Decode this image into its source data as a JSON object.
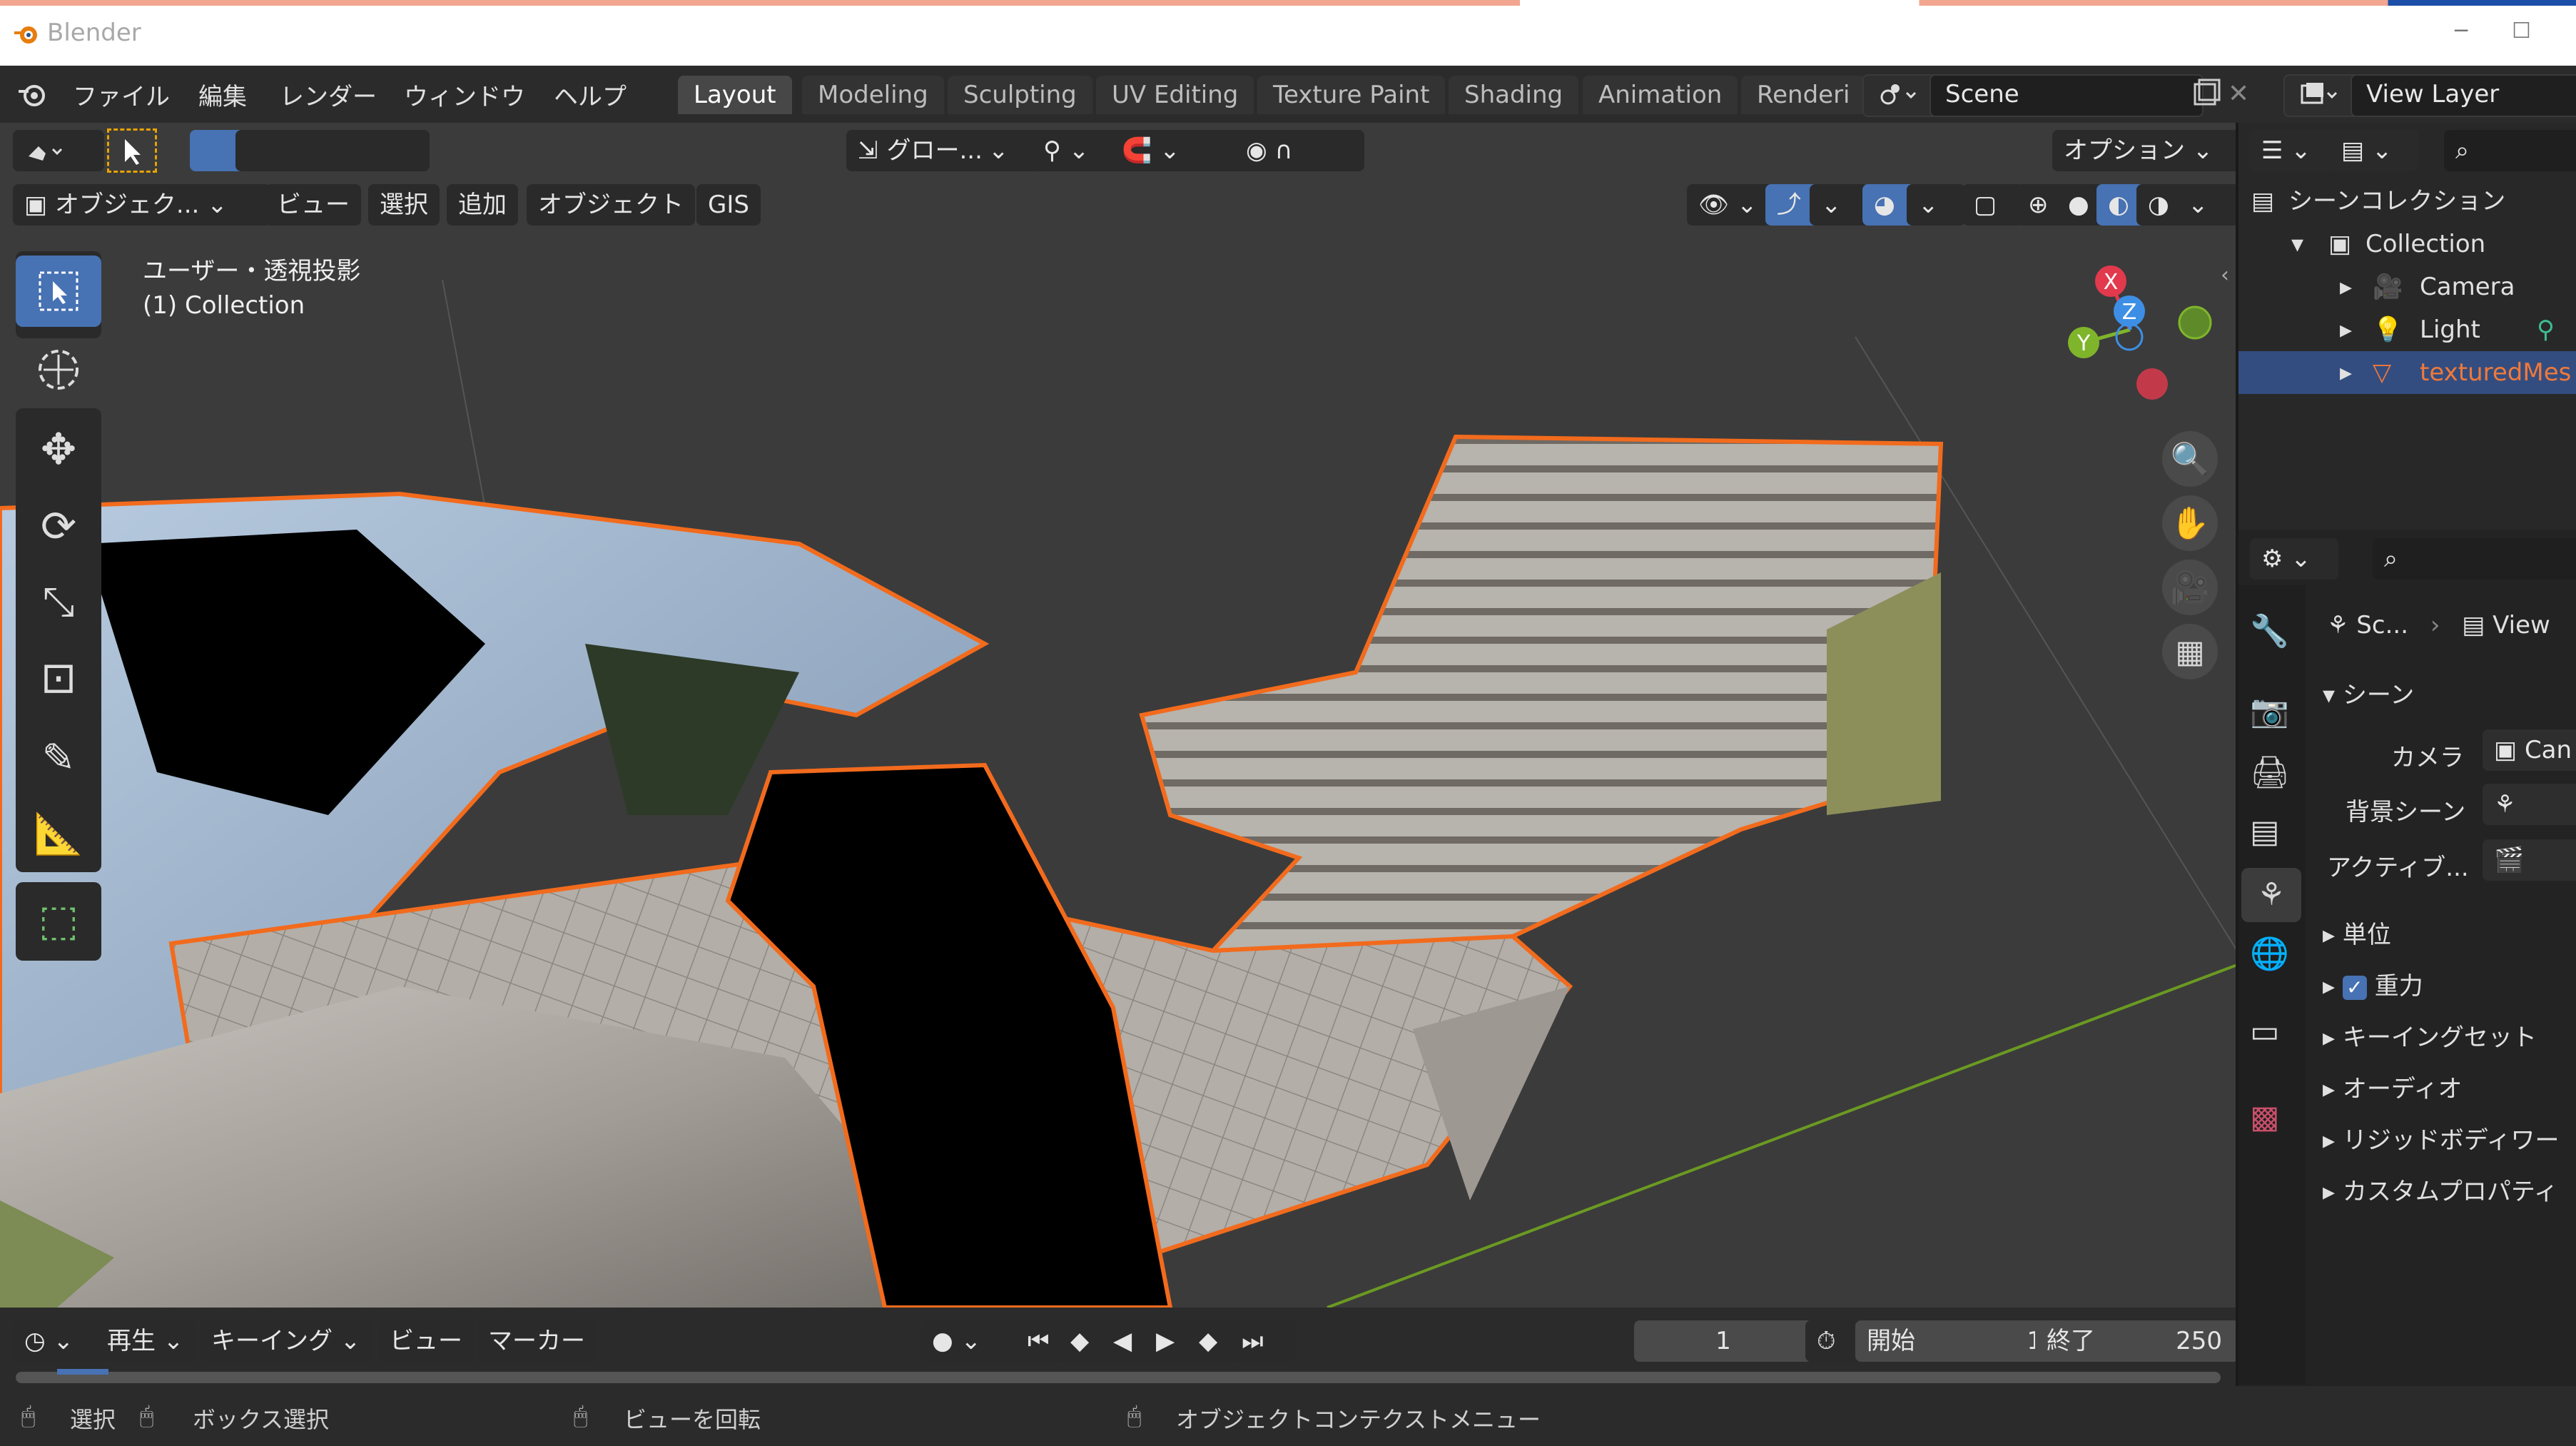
{
  "window": {
    "app_name": "Blender",
    "minimize": "─",
    "maximize": "☐"
  },
  "menubar": {
    "items": [
      "ファイル",
      "編集",
      "レンダー",
      "ウィンドウ",
      "ヘルプ"
    ],
    "workspace_tabs": [
      "Layout",
      "Modeling",
      "Sculpting",
      "UV Editing",
      "Texture Paint",
      "Shading",
      "Animation",
      "Renderi"
    ],
    "active_tab": "Layout",
    "scene_value": "Scene",
    "view_layer_value": "View Layer"
  },
  "viewport_header": {
    "transform_orientation": "グロー...",
    "options_label": "オプション",
    "mode_label": "オブジェク...",
    "menus": [
      "ビュー",
      "選択",
      "追加",
      "オブジェクト",
      "GIS"
    ]
  },
  "viewport": {
    "view_name": "ユーザー・透視投影",
    "collection_label": "(1) Collection",
    "axis_labels": {
      "x": "X",
      "y": "Y",
      "z": "Z"
    },
    "colors": {
      "selection_outline": "#f26b1d",
      "background": "#3b3b3b",
      "x_axis": "#e2394d",
      "y_axis": "#7fb52b",
      "z_axis": "#3d8fe5"
    }
  },
  "timeline": {
    "playback_label": "再生",
    "keying_label": "キーイング",
    "view_label": "ビュー",
    "marker_label": "マーカー",
    "current_frame": "1",
    "start_label": "開始",
    "start_value": "1",
    "end_label": "終了",
    "end_value": "250"
  },
  "statusbar": {
    "select_label": "選択",
    "box_select_label": "ボックス選択",
    "rotate_view_label": "ビューを回転",
    "context_menu_label": "オブジェクトコンテクストメニュー"
  },
  "outliner": {
    "scene_collection": "シーンコレクション",
    "items": [
      {
        "label": "Collection",
        "icon": "collection-icon"
      },
      {
        "label": "Camera",
        "icon": "camera-icon"
      },
      {
        "label": "Light",
        "icon": "light-icon"
      },
      {
        "label": "texturedMes",
        "icon": "mesh-icon",
        "selected": true
      }
    ]
  },
  "properties": {
    "breadcrumb_scene": "Sc...",
    "breadcrumb_view": "View",
    "section_scene": "シーン",
    "camera_label": "カメラ",
    "camera_value": "Can",
    "bg_scene_label": "背景シーン",
    "active_label": "アクティブ...",
    "panels": [
      "単位",
      "重力",
      "キーイングセット",
      "オーディオ",
      "リジッドボディワー",
      "カスタムプロパティ"
    ],
    "gravity_checked": true
  }
}
